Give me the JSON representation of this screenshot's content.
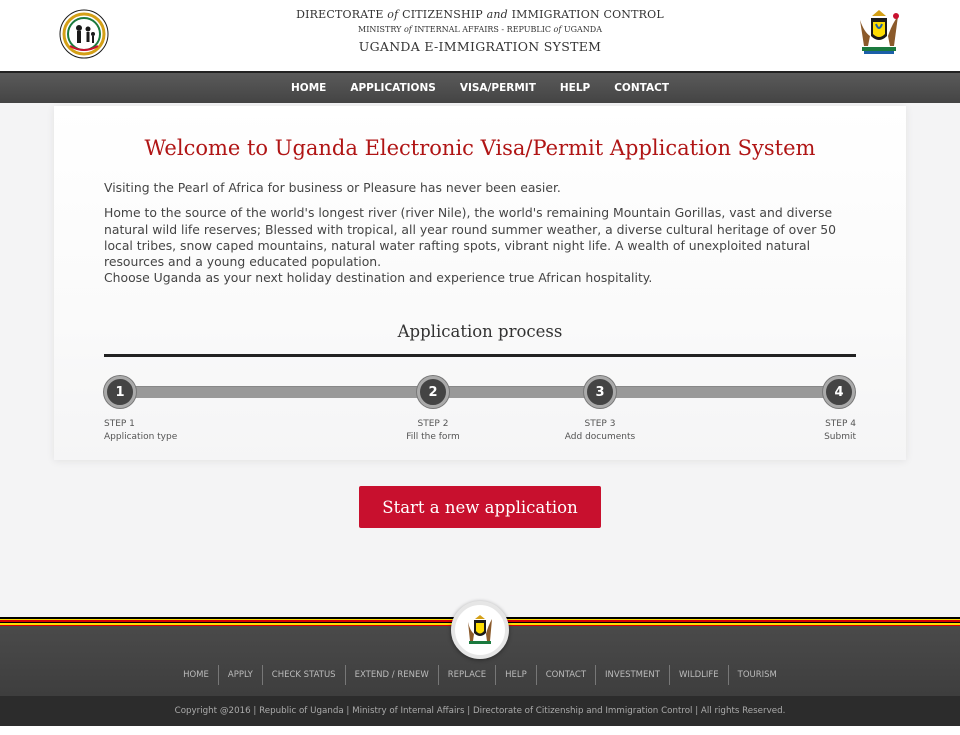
{
  "header": {
    "line1_pre": "DIRECTORATE",
    "line1_of": "of",
    "line1_mid": "CITIZENSHIP",
    "line1_and": "and",
    "line1_post": "IMMIGRATION CONTROL",
    "line2_pre": "MINISTRY",
    "line2_of": "of",
    "line2_mid": "INTERNAL AFFAIRS - REPUBLIC",
    "line2_of2": "of",
    "line2_post": "UGANDA",
    "line3": "UGANDA E-IMMIGRATION SYSTEM"
  },
  "nav": {
    "items": [
      "HOME",
      "APPLICATIONS",
      "VISA/PERMIT",
      "HELP",
      "CONTACT"
    ]
  },
  "main": {
    "title": "Welcome to Uganda Electronic Visa/Permit Application System",
    "para1": "Visiting the Pearl of Africa for business or Pleasure has never been easier.",
    "para2": "Home to the source of the world's longest river (river Nile), the world's remaining Mountain Gorillas, vast and diverse natural wild life reserves; Blessed with tropical, all year round summer weather, a diverse cultural heritage of over 50 local tribes, snow caped mountains, natural water rafting spots, vibrant night life. A wealth of unexploited natural resources and a young educated population.",
    "para3": "Choose Uganda as your next holiday destination and experience true African hospitality.",
    "process_title": "Application process",
    "steps": [
      {
        "num": "1",
        "label": "STEP 1",
        "desc": "Application type"
      },
      {
        "num": "2",
        "label": "STEP 2",
        "desc": "Fill the form"
      },
      {
        "num": "3",
        "label": "STEP 3",
        "desc": "Add documents"
      },
      {
        "num": "4",
        "label": "STEP 4",
        "desc": "Submit"
      }
    ],
    "start_button": "Start a new application"
  },
  "footer": {
    "links": [
      "HOME",
      "APPLY",
      "CHECK STATUS",
      "EXTEND / RENEW",
      "REPLACE",
      "HELP",
      "CONTACT",
      "INVESTMENT",
      "WILDLIFE",
      "TOURISM"
    ],
    "copyright": "Copyright @2016 | Republic of Uganda | Ministry of Internal Affairs | Directorate of Citizenship and Immigration Control | All rights Reserved."
  },
  "colors": {
    "accent_red": "#c8102e",
    "title_red": "#b01515",
    "nav_bg": "#4d4d4d",
    "flag_black": "#000000",
    "flag_yellow": "#fcdc04",
    "flag_red": "#d90000"
  }
}
